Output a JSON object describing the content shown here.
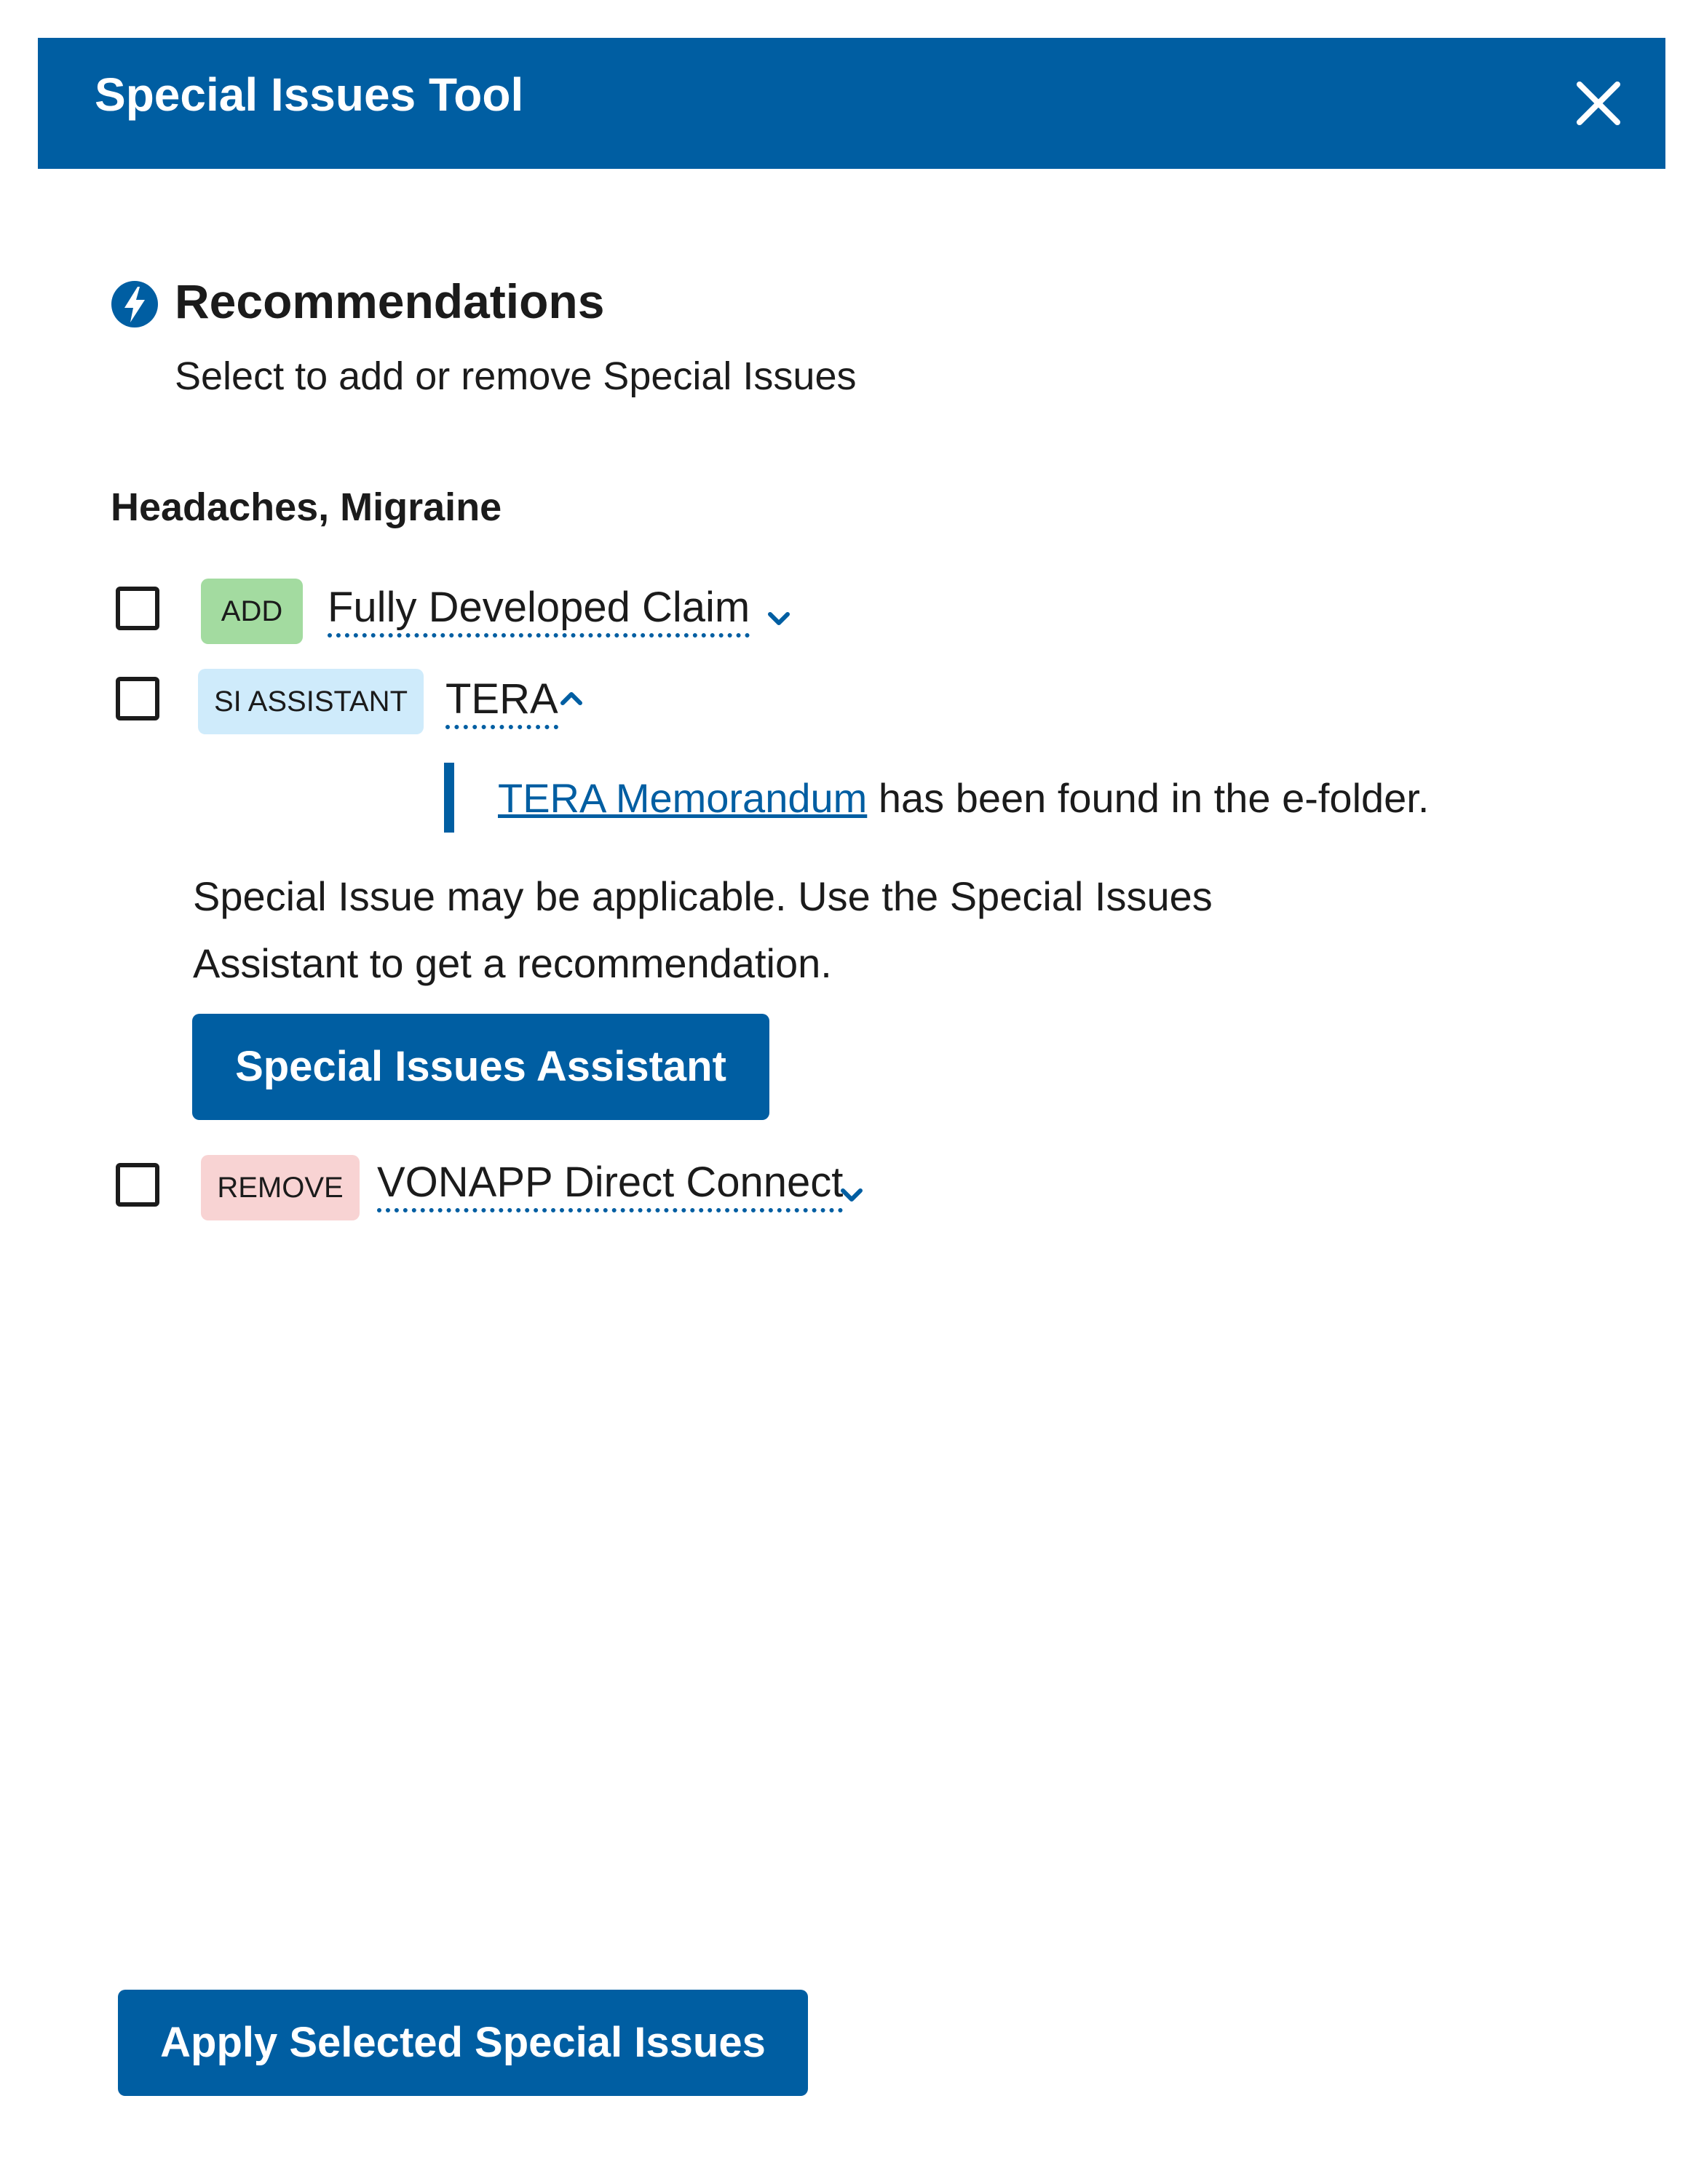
{
  "header": {
    "title": "Special Issues Tool",
    "close_icon": "close-icon"
  },
  "recommendations": {
    "icon": "lightning-bolt-icon",
    "title": "Recommendations",
    "subtitle": "Select to add or remove Special Issues"
  },
  "issue": {
    "title": "Headaches, Migraine",
    "items": [
      {
        "tag": "ADD",
        "label": "Fully Developed Claim",
        "expanded": false,
        "checked": false
      },
      {
        "tag": "SI ASSISTANT",
        "label": "TERA",
        "expanded": true,
        "checked": false
      },
      {
        "tag": "REMOVE",
        "label": "VONAPP Direct Connect",
        "expanded": false,
        "checked": false
      }
    ],
    "tera_detail": {
      "link_text": "TERA Memorandum",
      "found_text": " has been found in the e-folder.",
      "description": "Special Issue may be applicable. Use the Special Issues Assistant to get a recommendation.",
      "assistant_button": "Special Issues Assistant"
    }
  },
  "footer": {
    "apply_button": "Apply Selected Special Issues"
  },
  "colors": {
    "primary": "#005ea2",
    "tag_add": "#a3dba0",
    "tag_assistant": "#cfebfb",
    "tag_remove": "#f8d3d3"
  }
}
